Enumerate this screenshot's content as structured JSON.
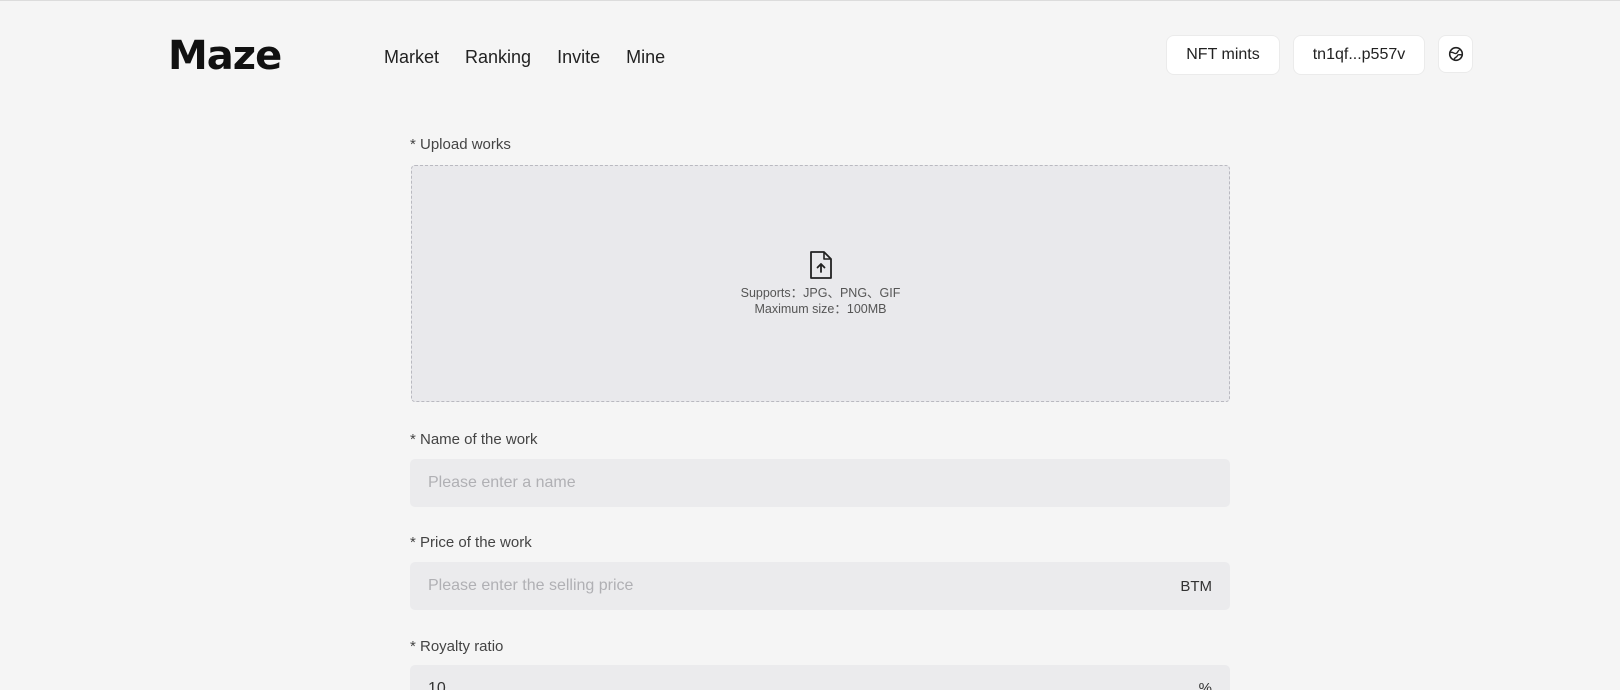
{
  "header": {
    "logo": "Maze",
    "nav": [
      "Market",
      "Ranking",
      "Invite",
      "Mine"
    ],
    "nft_mints_label": "NFT mints",
    "wallet_label": "tn1qf...p557v",
    "settings_icon": "globe-icon"
  },
  "form": {
    "upload": {
      "label": "* Upload works",
      "icon": "file-upload-icon",
      "supports": "Supports：JPG、PNG、GIF",
      "max_size": "Maximum size：100MB"
    },
    "name": {
      "label": "* Name of the work",
      "placeholder": "Please enter a name",
      "value": ""
    },
    "price": {
      "label": "* Price of the work",
      "placeholder": "Please enter the selling price",
      "value": "",
      "unit": "BTM"
    },
    "royalty": {
      "label": "* Royalty ratio",
      "value": "10",
      "unit": "%"
    }
  }
}
